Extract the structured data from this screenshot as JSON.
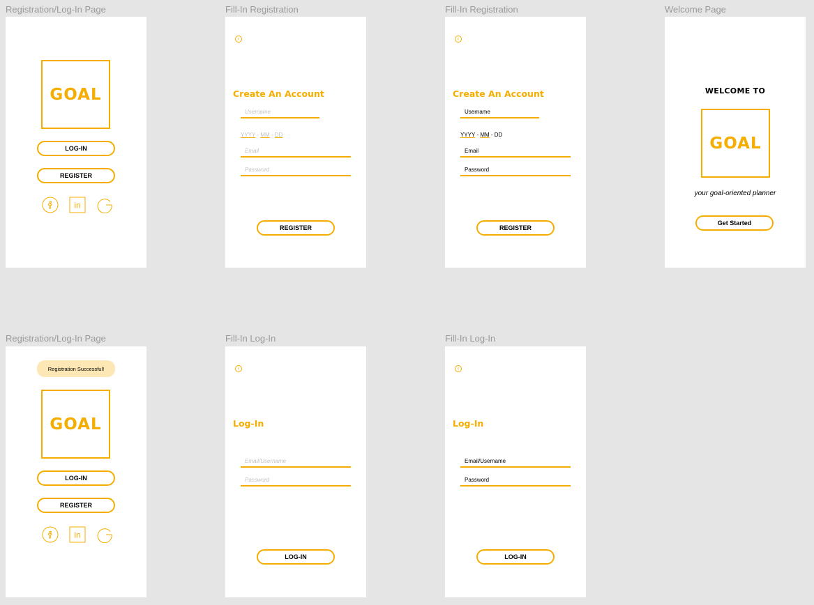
{
  "frames": {
    "f1": {
      "label": "Registration/Log-In Page",
      "logo": "GOAL",
      "login_label": "LOG-IN",
      "register_label": "REGISTER",
      "social": [
        "facebook-icon",
        "linkedin-icon",
        "google-icon"
      ]
    },
    "f2": {
      "label": "Fill-In Registration",
      "heading": "Create An Account",
      "username_placeholder": "Username",
      "date": {
        "yyyy": "YYYY",
        "mm": "MM",
        "dd": "DD"
      },
      "email_placeholder": "Email",
      "password_placeholder": "Password",
      "register_label": "REGISTER"
    },
    "f3": {
      "label": "Fill-In Registration",
      "heading": "Create An Account",
      "username_value": "Username",
      "date": {
        "yyyy": "YYYY",
        "mm": "MM",
        "dd": "DD"
      },
      "email_value": "Email",
      "password_value": "Password",
      "register_label": "REGISTER"
    },
    "f4": {
      "label": "Welcome Page",
      "welcome_title": "WELCOME TO",
      "logo": "GOAL",
      "tagline": "your goal-oriented planner",
      "cta_label": "Get Started"
    },
    "f5": {
      "label": "Registration/Log-In Page",
      "toast": "Registration Successful!",
      "logo": "GOAL",
      "login_label": "LOG-IN",
      "register_label": "REGISTER",
      "social": [
        "facebook-icon",
        "linkedin-icon",
        "google-icon"
      ]
    },
    "f6": {
      "label": "Fill-In Log-In",
      "heading": "Log-In",
      "email_placeholder": "Email/Username",
      "password_placeholder": "Password",
      "login_label": "LOG-IN"
    },
    "f7": {
      "label": "Fill-In Log-In",
      "heading": "Log-In",
      "email_value": "Email/Username",
      "password_value": "Password",
      "login_label": "LOG-IN"
    }
  },
  "colors": {
    "accent": "#f5ad00",
    "toast_bg": "#fde7b5",
    "canvas": "#e5e5e5",
    "placeholder": "#c2c2c2"
  }
}
